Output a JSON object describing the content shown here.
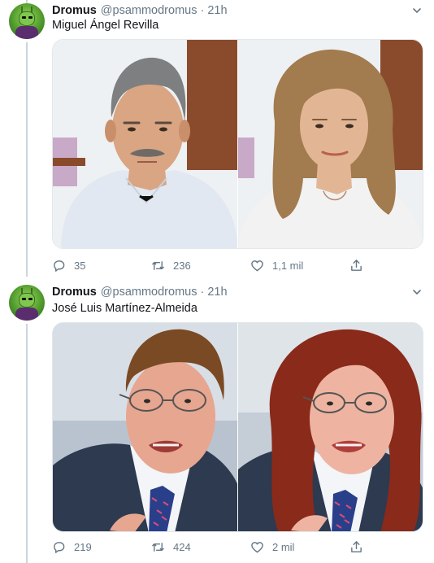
{
  "tweets": [
    {
      "name": "Dromus",
      "handle": "@psammodromus",
      "separator": "·",
      "time": "21h",
      "text": "Miguel Ángel Revilla",
      "replies": "35",
      "retweets": "236",
      "likes": "1,1 mil",
      "photos": [
        {
          "subject": "original-portrait",
          "background": "#eef1f3",
          "skin": "#d9a582",
          "hair": "#7d7f80",
          "clothing": "#e2e8f1"
        },
        {
          "subject": "gender-swapped-portrait",
          "background": "#eef1f3",
          "skin": "#e2b695",
          "hair": "#a27b4f",
          "clothing": "#f2f2f2"
        }
      ]
    },
    {
      "name": "Dromus",
      "handle": "@psammodromus",
      "separator": "·",
      "time": "21h",
      "text": "José Luis Martínez-Almeida",
      "replies": "219",
      "retweets": "424",
      "likes": "2 mil",
      "photos": [
        {
          "subject": "original-portrait",
          "background": "#b9c3cf",
          "skin": "#e7a690",
          "hair": "#7a4a25",
          "clothing": "#2d3a4f"
        },
        {
          "subject": "gender-swapped-portrait",
          "background": "#c5cdd7",
          "skin": "#eeb4a1",
          "hair": "#8a2a1a",
          "clothing": "#2d3a4f"
        }
      ]
    }
  ],
  "colors": {
    "text_primary": "#14171a",
    "text_secondary": "#657786",
    "thread_line": "#ccd6dd",
    "border": "#e1e8ed"
  },
  "icons": {
    "reply": "reply-icon",
    "retweet": "retweet-icon",
    "like": "heart-icon",
    "share": "share-icon",
    "caret": "chevron-down-icon"
  }
}
